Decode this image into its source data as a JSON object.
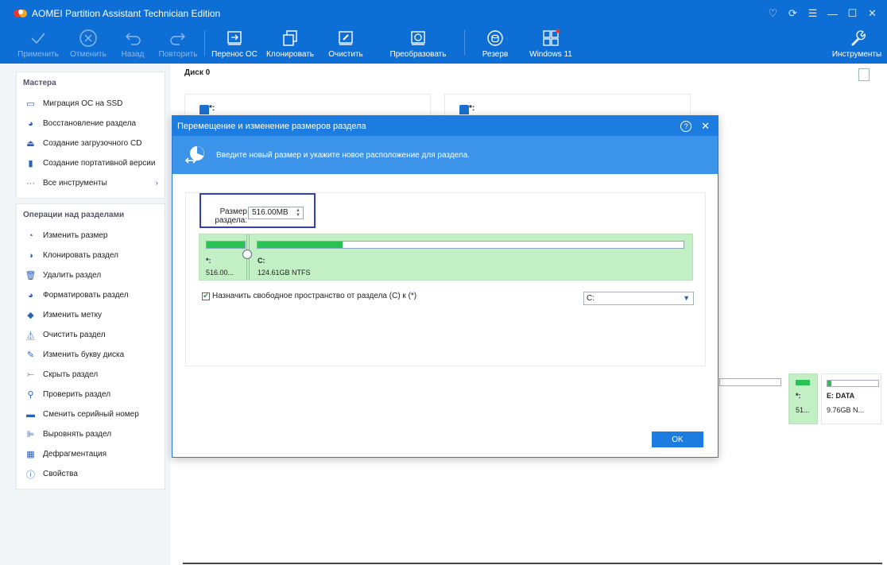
{
  "window": {
    "title": "AOMEI Partition Assistant Technician Edition"
  },
  "toolbar": {
    "apply": "Применить",
    "discard": "Отменить",
    "undo": "Назад",
    "redo": "Повторить",
    "migrate_os": "Перенос ОС",
    "clone": "Клонировать",
    "wipe": "Очистить",
    "convert": "Преобразовать",
    "backup": "Резерв",
    "windows11": "Windows 11",
    "tools": "Инструменты"
  },
  "sidebar": {
    "wizards": {
      "header": "Мастера",
      "items": [
        {
          "label": "Миграция ОС на SSD"
        },
        {
          "label": "Восстановление раздела"
        },
        {
          "label": "Создание загрузочного CD"
        },
        {
          "label": "Создание портативной версии"
        },
        {
          "label": "Все инструменты"
        }
      ]
    },
    "operations": {
      "header": "Операции над разделами",
      "items": [
        {
          "label": "Изменить размер"
        },
        {
          "label": "Клонировать раздел"
        },
        {
          "label": "Удалить раздел"
        },
        {
          "label": "Форматировать раздел"
        },
        {
          "label": "Изменить метку"
        },
        {
          "label": "Очистить раздел"
        },
        {
          "label": "Изменить букву диска"
        },
        {
          "label": "Скрыть раздел"
        },
        {
          "label": "Проверить раздел"
        },
        {
          "label": "Сменить серийный номер"
        },
        {
          "label": "Выровнять раздел"
        },
        {
          "label": "Дефрагментация"
        },
        {
          "label": "Свойства"
        }
      ]
    }
  },
  "disk": {
    "title": "Диск 0",
    "card1_name": "*:",
    "card2_name": "*:",
    "strip_part1_name": "*:",
    "strip_part1_size": "51...",
    "strip_part2_name": "E: DATA",
    "strip_part2_size": "9.76GB N..."
  },
  "dialog": {
    "title": "Перемещение и изменение размеров раздела",
    "help": "?",
    "banner_text": "Введите новый размер и укажите новое расположение для раздела.",
    "size_label": "Размер раздела:",
    "size_value": "516.00MB",
    "part1_name": "*:",
    "part1_size": "516.00...",
    "part1_fill": 1.0,
    "part2_name": "C:",
    "part2_size": "124.61GB NTFS",
    "part2_fill": 0.2,
    "assign_label": "Назначить свободное пространство от раздела (C) к (*)",
    "assign_checked": true,
    "target_value": "C:",
    "ok": "OK"
  }
}
